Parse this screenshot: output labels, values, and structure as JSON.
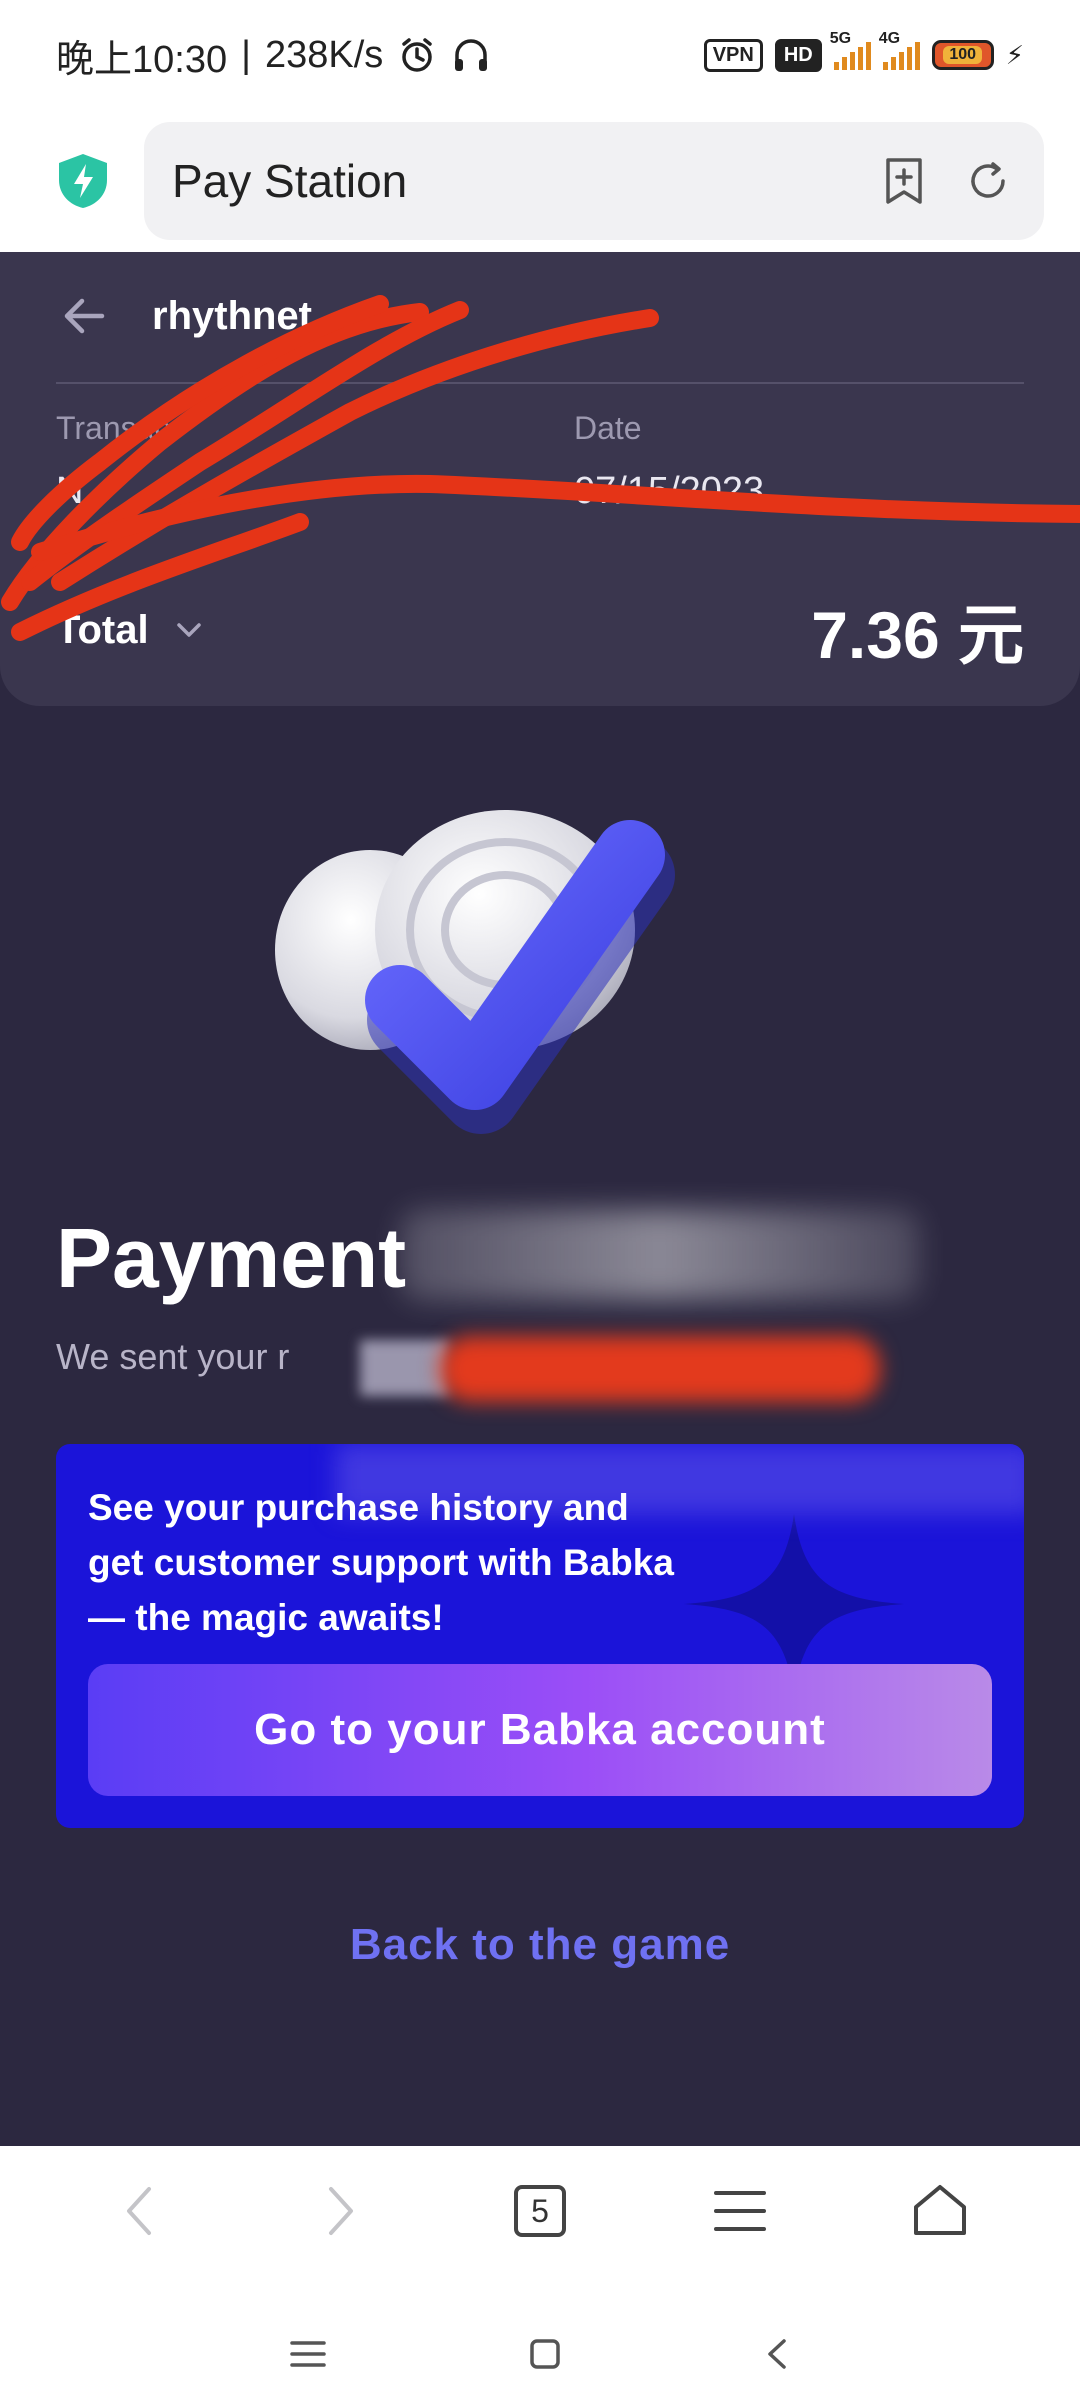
{
  "status_bar": {
    "time": "晚上10:30",
    "net_speed": "238K/s",
    "vpn": "VPN",
    "hd": "HD",
    "net_5g": "5G",
    "net_4g": "4G",
    "battery": "100"
  },
  "browser": {
    "address_text": "Pay Station"
  },
  "header": {
    "merchant": "rhythnet",
    "transaction_label": "Transac",
    "transaction_value": "N",
    "date_label": "Date",
    "date_value": "07/15/2023",
    "total_label": "Total",
    "total_amount": "7.36 元"
  },
  "result": {
    "title": "Payment",
    "sent_text": "We sent your r"
  },
  "promo": {
    "text": "See your purchase history and get customer support with Babka — the magic awaits!",
    "button_label": "Go to your Babka account"
  },
  "back_to_game": "Back to the game",
  "bottom_bar": {
    "tab_count": "5"
  },
  "colors": {
    "page_bg": "#2c2840",
    "header_bg": "#3a364e",
    "promo_bg": "#1b14d9",
    "link": "#6f71f2",
    "redaction": "#e33a1d"
  }
}
